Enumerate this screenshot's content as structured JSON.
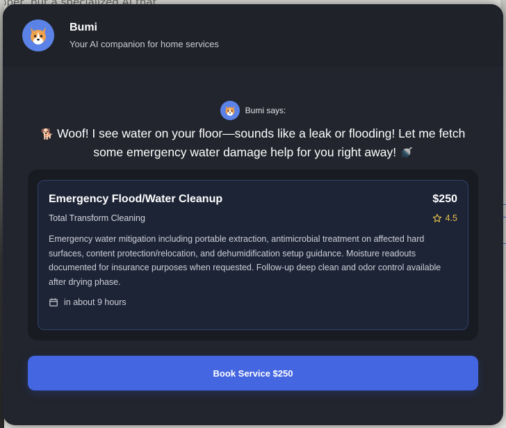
{
  "background": {
    "text": "pper, but a specialized AI that"
  },
  "header": {
    "avatar_icon": "corgi-avatar-icon",
    "title": "Bumi",
    "subtitle": "Your AI companion for home services"
  },
  "assistant": {
    "says_label": "Bumi says:",
    "message_emoji_start": "🐕",
    "message": "Woof! I see water on your floor—sounds like a leak or flooding! Let me fetch some emergency water damage help for you right away!",
    "message_emoji_end": "🚿"
  },
  "service": {
    "title": "Emergency Flood/Water Cleanup",
    "price": "$250",
    "provider": "Total Transform Cleaning",
    "rating": "4.5",
    "description": "Emergency water mitigation including portable extraction, antimicrobial treatment on affected hard surfaces, content protection/relocation, and dehumidification setup guidance. Moisture readouts documented for insurance purposes when requested. Follow-up deep clean and odor control available after drying phase.",
    "availability": "in about 9 hours"
  },
  "actions": {
    "book_label": "Book Service $250"
  },
  "colors": {
    "modal_bg": "#22252d",
    "card_bg": "#1d2436",
    "accent": "#4466e0",
    "rating": "#e7c04e"
  }
}
